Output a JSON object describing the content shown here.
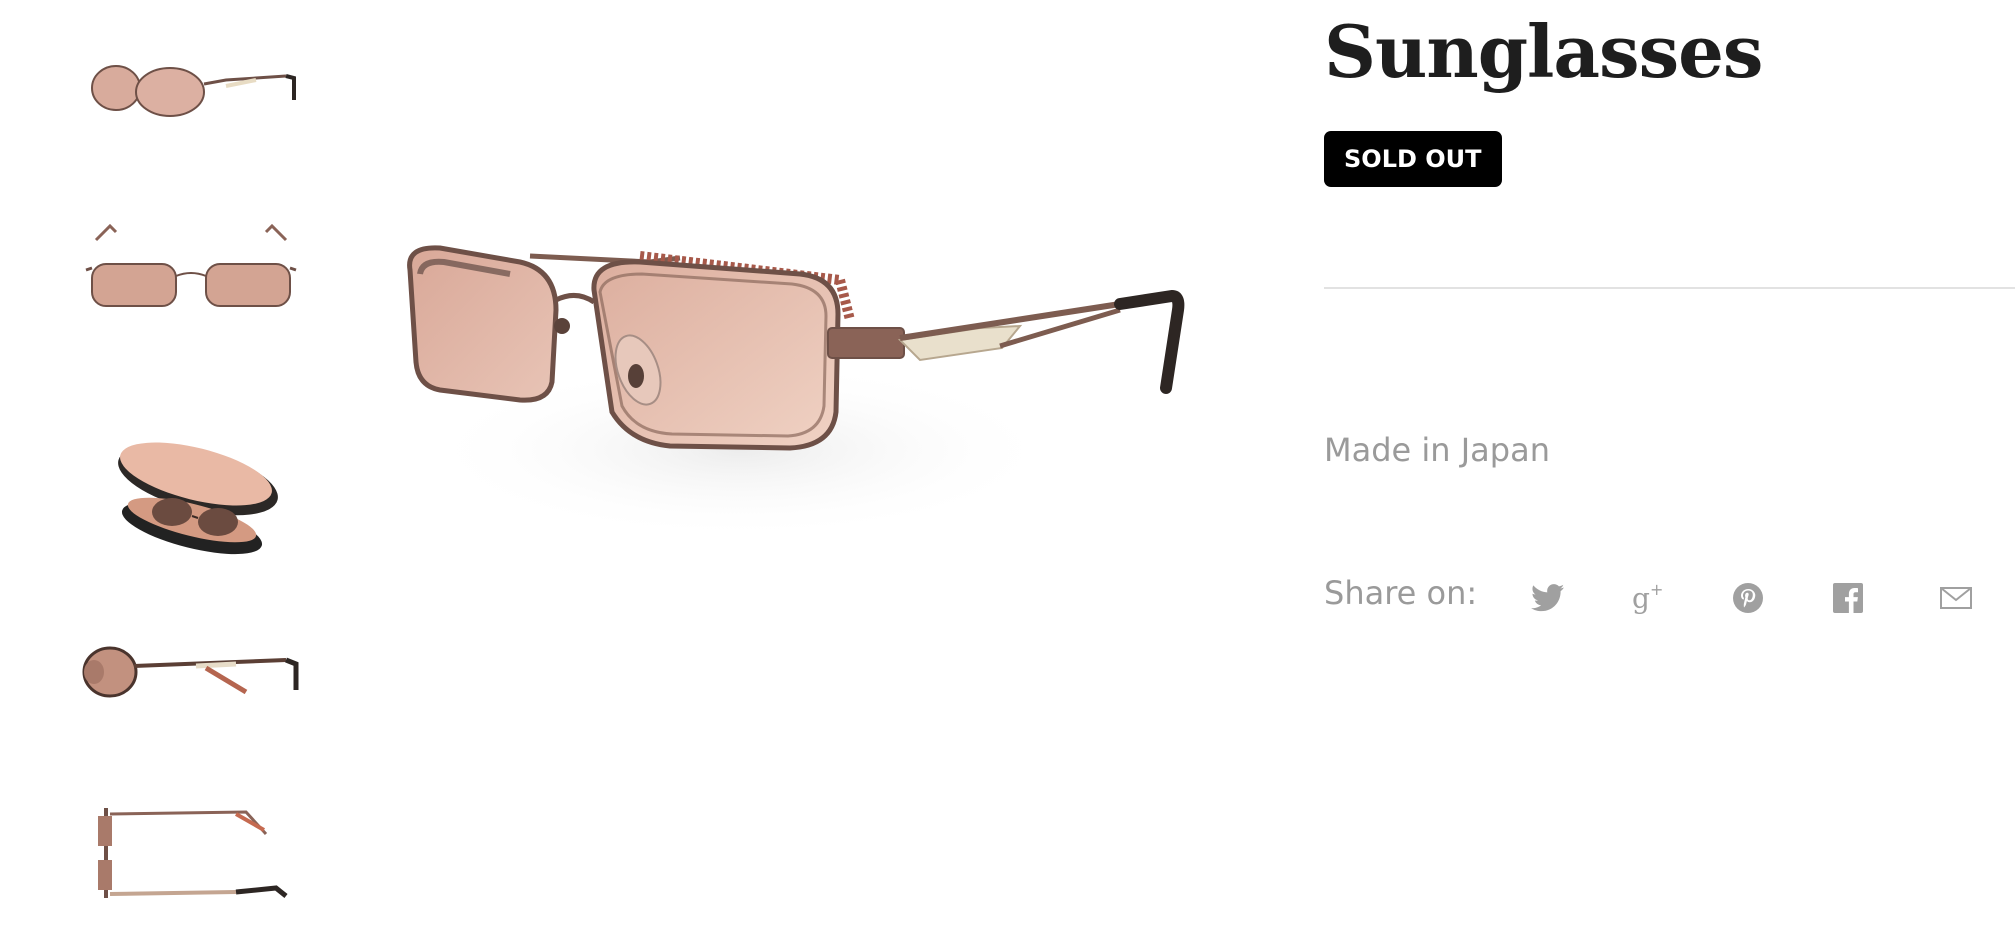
{
  "product": {
    "title": "Sunglasses",
    "badge": "SOLD OUT",
    "description": "Made in Japan"
  },
  "share": {
    "label": "Share on:",
    "icons": [
      "twitter-icon",
      "google-plus-icon",
      "pinterest-icon",
      "facebook-icon",
      "email-icon"
    ]
  },
  "colors": {
    "icon_gray": "#a0a0a0",
    "text_gray": "#9a9a9a",
    "frame_brown": "#7a5a4e",
    "lens_tint": "#d9a898",
    "badge_bg": "#000000"
  }
}
